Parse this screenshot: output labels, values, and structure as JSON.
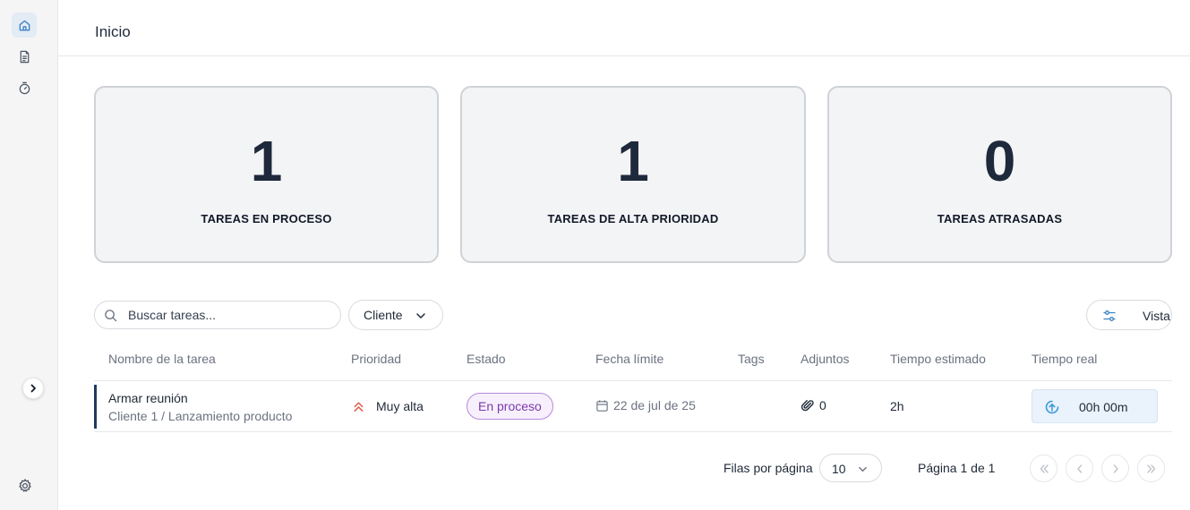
{
  "header": {
    "title": "Inicio"
  },
  "sidebar": {
    "items": [
      {
        "icon": "home-icon",
        "active": true
      },
      {
        "icon": "document-icon",
        "active": false
      },
      {
        "icon": "stopwatch-icon",
        "active": false
      }
    ],
    "settings_icon": "gear-icon",
    "expand_icon": "chevron-right-icon"
  },
  "stats": [
    {
      "value": "1",
      "label": "TAREAS EN PROCESO"
    },
    {
      "value": "1",
      "label": "TAREAS DE ALTA PRIORIDAD"
    },
    {
      "value": "0",
      "label": "TAREAS ATRASADAS"
    }
  ],
  "toolbar": {
    "search_placeholder": "Buscar tareas...",
    "client_filter": "Cliente",
    "view_label": "Vista"
  },
  "table": {
    "columns": [
      "Nombre de la tarea",
      "Prioridad",
      "Estado",
      "Fecha límite",
      "Tags",
      "Adjuntos",
      "Tiempo estimado",
      "Tiempo real"
    ],
    "rows": [
      {
        "name": "Armar reunión",
        "subtitle": "Cliente 1 / Lanzamiento producto",
        "priority": "Muy alta",
        "status": "En proceso",
        "due_date": "22 de jul de 25",
        "tags": "",
        "attachments": "0",
        "estimated": "2h",
        "real": "00h 00m"
      }
    ]
  },
  "pagination": {
    "rows_per_page_label": "Filas por página",
    "rows_per_page_value": "10",
    "page_info": "Página 1 de 1"
  },
  "colors": {
    "accent": "#1e3a5f",
    "status_border": "#b48ad9",
    "status_text": "#7c3aad",
    "priority_icon": "#e15b4a",
    "timer_icon": "#3b9ad9"
  }
}
